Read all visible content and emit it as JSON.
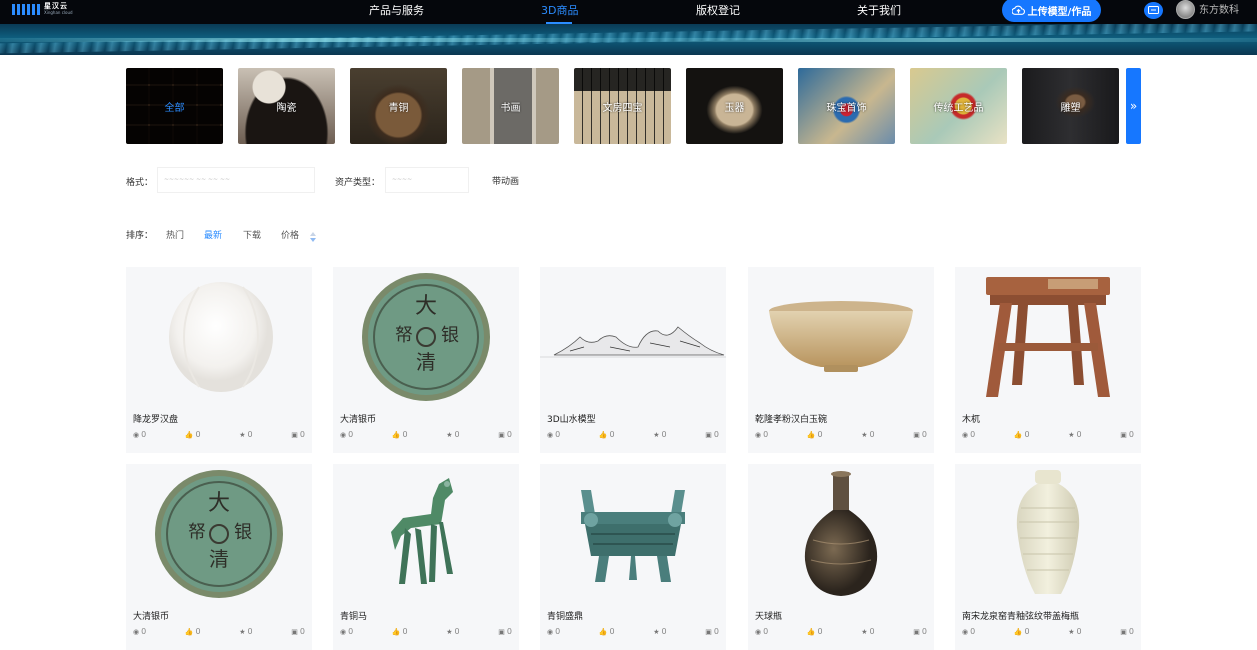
{
  "header": {
    "logo_text": "星汉云",
    "logo_sub": "Xinghan cloud",
    "nav": [
      {
        "label": "产品与服务",
        "active": false
      },
      {
        "label": "3D商品",
        "active": true
      },
      {
        "label": "版权登记",
        "active": false
      },
      {
        "label": "关于我们",
        "active": false
      }
    ],
    "upload_label": "上传模型/作品",
    "username": "东方数科"
  },
  "categories": [
    {
      "label": "全部",
      "active": true,
      "icon": "grid-thumbnails"
    },
    {
      "label": "陶瓷",
      "active": false,
      "icon": "lanterns-photo"
    },
    {
      "label": "青铜",
      "active": false,
      "icon": "bronze-vessel-photo"
    },
    {
      "label": "书画",
      "active": false,
      "icon": "painting-photo"
    },
    {
      "label": "文房四宝",
      "active": false,
      "icon": "calligraphy-photo"
    },
    {
      "label": "玉器",
      "active": false,
      "icon": "jade-vessel-photo"
    },
    {
      "label": "珠宝首饰",
      "active": false,
      "icon": "jewelry-photo"
    },
    {
      "label": "传统工艺品",
      "active": false,
      "icon": "crafts-photo"
    },
    {
      "label": "雕塑",
      "active": false,
      "icon": "sculpture-photo"
    }
  ],
  "filters": {
    "format_label": "格式：",
    "format_value": "~~~~~~ ~~ ~~ ~~",
    "asset_type_label": "资产类型：",
    "asset_type_value": "~~~~",
    "animation_label": "带动画"
  },
  "sort": {
    "label": "排序：",
    "options": [
      {
        "label": "热门",
        "active": false
      },
      {
        "label": "最新",
        "active": true
      },
      {
        "label": "下载",
        "active": false
      },
      {
        "label": "价格",
        "active": false
      }
    ]
  },
  "items": [
    {
      "title": "降龙罗汉盘",
      "views": "0",
      "likes": "0",
      "favorites": "0",
      "downloads": "0",
      "image": "white-plate"
    },
    {
      "title": "大清银币",
      "views": "0",
      "likes": "0",
      "favorites": "0",
      "downloads": "0",
      "image": "silver-coin"
    },
    {
      "title": "3D山水模型",
      "views": "0",
      "likes": "0",
      "favorites": "0",
      "downloads": "0",
      "image": "mountain-landscape"
    },
    {
      "title": "乾隆孝粉汉白玉碗",
      "views": "0",
      "likes": "0",
      "favorites": "0",
      "downloads": "0",
      "image": "jade-bowl"
    },
    {
      "title": "木杌",
      "views": "0",
      "likes": "0",
      "favorites": "0",
      "downloads": "0",
      "image": "wooden-stool"
    },
    {
      "title": "大清银币",
      "views": "0",
      "likes": "0",
      "favorites": "0",
      "downloads": "0",
      "image": "silver-coin"
    },
    {
      "title": "青铜马",
      "views": "0",
      "likes": "0",
      "favorites": "0",
      "downloads": "0",
      "image": "bronze-horse"
    },
    {
      "title": "青铜盛鼎",
      "views": "0",
      "likes": "0",
      "favorites": "0",
      "downloads": "0",
      "image": "bronze-ding"
    },
    {
      "title": "天球瓶",
      "views": "0",
      "likes": "0",
      "favorites": "0",
      "downloads": "0",
      "image": "globe-vase"
    },
    {
      "title": "南宋龙泉窑青釉弦纹带盖梅瓶",
      "views": "0",
      "likes": "0",
      "favorites": "0",
      "downloads": "0",
      "image": "celadon-meiping"
    }
  ],
  "colors": {
    "accent": "#1677ff",
    "active_text": "#2b8cff",
    "topbar": "#05070c",
    "card_bg": "#f6f7f9"
  }
}
